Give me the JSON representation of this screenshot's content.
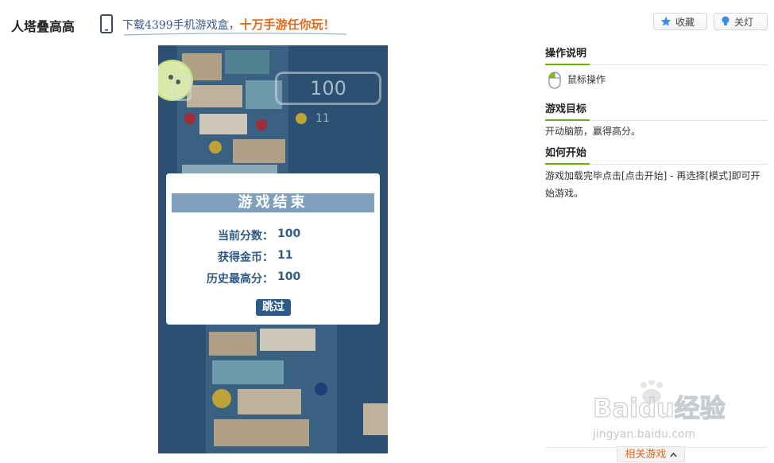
{
  "page": {
    "title": "人塔叠高高",
    "promo_text": "下载4399手机游戏盒，",
    "promo_accent": "十万手游任你玩",
    "promo_exclaim": "！"
  },
  "header_buttons": {
    "favorite_label": "收藏",
    "lights_label": "关灯"
  },
  "game": {
    "score": "100",
    "coins": "11",
    "modal": {
      "title": "游戏结束",
      "stats": [
        {
          "label": "当前分数：",
          "value": "100"
        },
        {
          "label": "获得金币：",
          "value": "11"
        },
        {
          "label": "历史最高分：",
          "value": "100"
        }
      ],
      "skip_label": "跳过"
    }
  },
  "sidebar": {
    "controls_title": "操作说明",
    "controls_mouse": "鼠标操作",
    "goal_title": "游戏目标",
    "goal_text": "开动脑筋，赢得高分。",
    "start_title": "如何开始",
    "start_text": "游戏加载完毕点击[点击开始] - 再选择[模式]即可开始游戏。",
    "related_label": "相关游戏"
  },
  "watermark": {
    "brand": "Baidu经验",
    "url": "jingyan.baidu.com"
  },
  "colors": {
    "game_bg": "#2c5072",
    "modal_header": "#7f9fbd",
    "accent_green": "#6fb000",
    "accent_orange": "#e06a1c",
    "stat_text": "#2f5a86"
  },
  "icons": [
    "phone-icon",
    "star-icon",
    "bulb-icon",
    "mouse-icon",
    "pause-icon",
    "chevron-up-icon"
  ]
}
